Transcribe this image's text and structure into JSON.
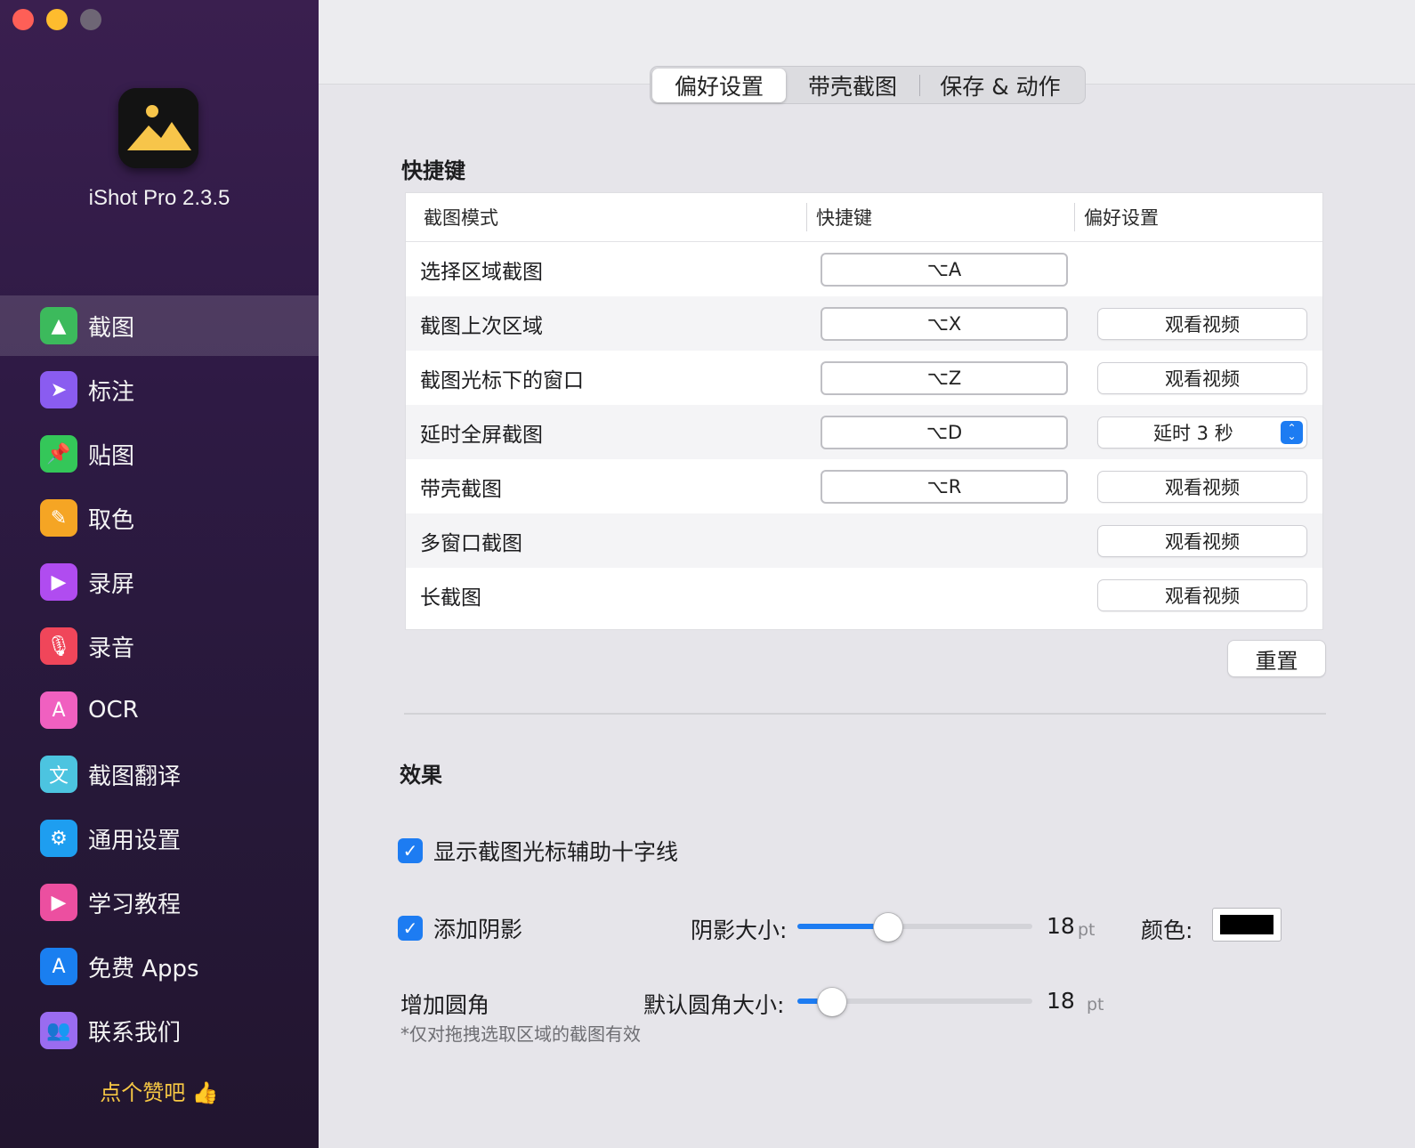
{
  "app": {
    "name": "iShot Pro 2.3.5",
    "like_text": "点个赞吧 👍"
  },
  "colors": {
    "accent": "#1d7cf2",
    "shadow_color": "#000000"
  },
  "sidebar": {
    "items": [
      {
        "label": "截图",
        "icon": "screenshot-icon",
        "glyph": "▲",
        "bg": "#3cba5c",
        "active": true
      },
      {
        "label": "标注",
        "icon": "pointer-icon",
        "glyph": "➤",
        "bg": "#8a5cf0",
        "active": false
      },
      {
        "label": "贴图",
        "icon": "pin-icon",
        "glyph": "📌",
        "bg": "#34c759",
        "active": false
      },
      {
        "label": "取色",
        "icon": "eyedropper-icon",
        "glyph": "✎",
        "bg": "#f5a524",
        "active": false
      },
      {
        "label": "录屏",
        "icon": "video-icon",
        "glyph": "▶",
        "bg": "#b04cf0",
        "active": false
      },
      {
        "label": "录音",
        "icon": "microphone-icon",
        "glyph": "🎙",
        "bg": "#f0465a",
        "active": false
      },
      {
        "label": "OCR",
        "icon": "ocr-icon",
        "glyph": "A",
        "bg": "#f060c0",
        "active": false
      },
      {
        "label": "截图翻译",
        "icon": "translate-icon",
        "glyph": "文",
        "bg": "#4cc4e0",
        "active": false
      },
      {
        "label": "通用设置",
        "icon": "gear-icon",
        "glyph": "⚙",
        "bg": "#1e9ef0",
        "active": false
      },
      {
        "label": "学习教程",
        "icon": "tutorial-icon",
        "glyph": "▶",
        "bg": "#ec4fa0",
        "active": false
      },
      {
        "label": "免费 Apps",
        "icon": "app-store-icon",
        "glyph": "A",
        "bg": "#1a7ff0",
        "active": false
      },
      {
        "label": "联系我们",
        "icon": "contacts-icon",
        "glyph": "👥",
        "bg": "#9a6cf0",
        "active": false
      }
    ]
  },
  "tabs": [
    {
      "label": "偏好设置",
      "active": true
    },
    {
      "label": "带壳截图",
      "active": false
    },
    {
      "label": "保存 & 动作",
      "active": false
    }
  ],
  "shortcuts": {
    "title": "快捷键",
    "headers": [
      "截图模式",
      "快捷键",
      "偏好设置"
    ],
    "rows": [
      {
        "mode": "选择区域截图",
        "key": "⌥A",
        "pref": ""
      },
      {
        "mode": "截图上次区域",
        "key": "⌥X",
        "pref": "观看视频"
      },
      {
        "mode": "截图光标下的窗口",
        "key": "⌥Z",
        "pref": "观看视频"
      },
      {
        "mode": "延时全屏截图",
        "key": "⌥D",
        "pref": "延时 3 秒",
        "pref_type": "select"
      },
      {
        "mode": "带壳截图",
        "key": "⌥R",
        "pref": "观看视频"
      },
      {
        "mode": "多窗口截图",
        "key": "",
        "pref": "观看视频"
      },
      {
        "mode": "长截图",
        "key": "",
        "pref": "观看视频"
      }
    ],
    "reset_label": "重置"
  },
  "effects": {
    "title": "效果",
    "crosshair_label": "显示截图光标辅助十字线",
    "crosshair_checked": true,
    "shadow_label": "添加阴影",
    "shadow_checked": true,
    "shadow_size_label": "阴影大小:",
    "shadow_size_value": "18",
    "shadow_size_fraction": 0.37,
    "unit": "pt",
    "color_label": "颜色:",
    "corner_label": "增加圆角",
    "corner_note": "*仅对拖拽选取区域的截图有效",
    "corner_size_label": "默认圆角大小:",
    "corner_size_value": "18",
    "corner_size_fraction": 0.1
  }
}
